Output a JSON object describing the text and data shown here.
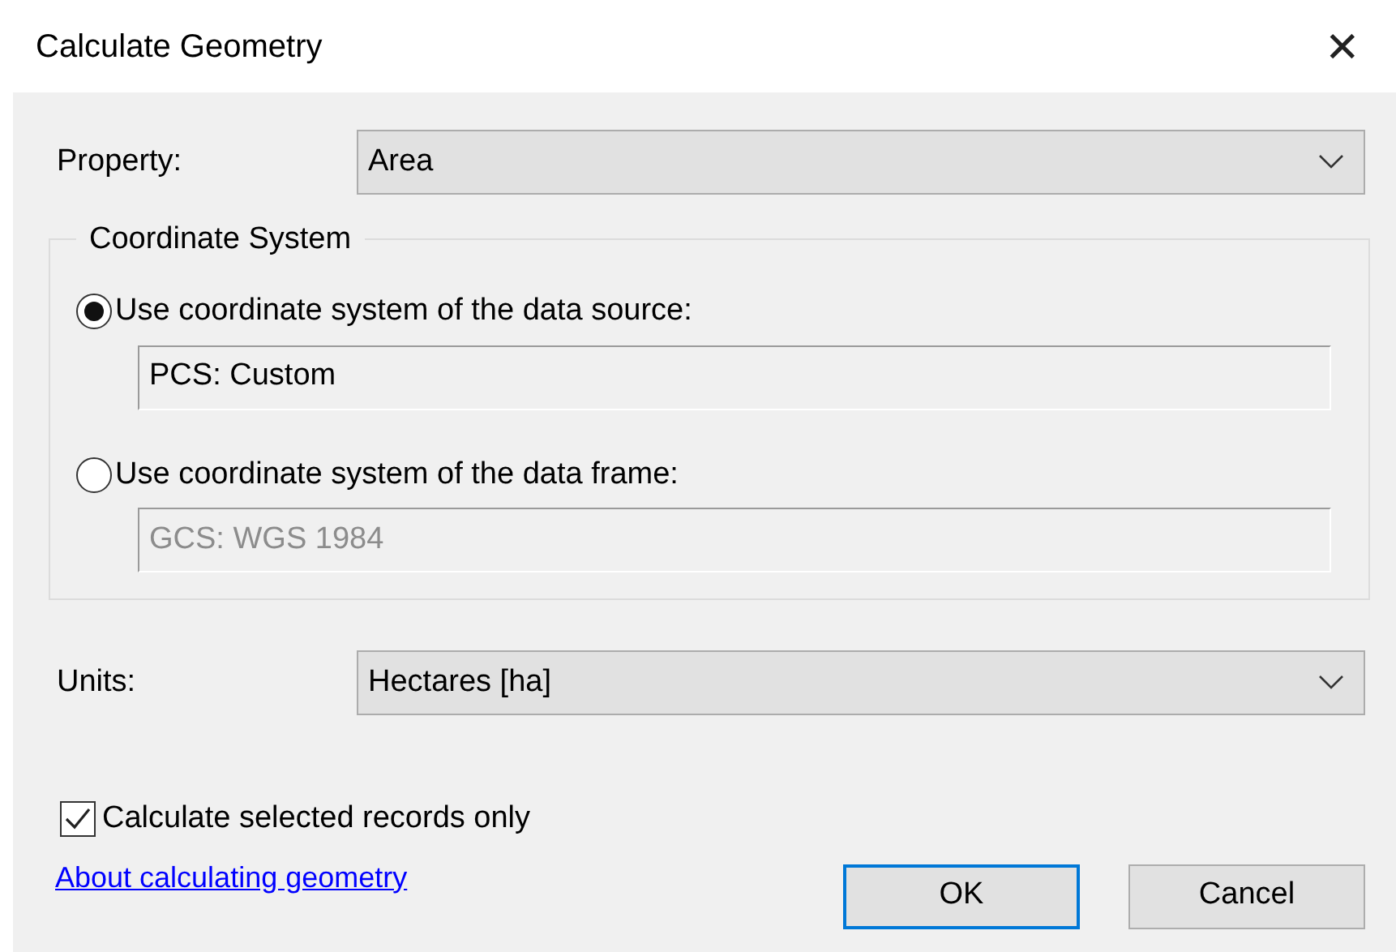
{
  "window": {
    "title": "Calculate Geometry",
    "close": "✕"
  },
  "property": {
    "label": "Property:",
    "value": "Area"
  },
  "coordinate_system": {
    "legend": "Coordinate System",
    "options": [
      {
        "label": "Use coordinate system of the data source:",
        "selected": true,
        "value": "PCS: Custom",
        "disabled": false
      },
      {
        "label": "Use coordinate system of the data frame:",
        "selected": false,
        "value": "GCS: WGS 1984",
        "disabled": true
      }
    ]
  },
  "units": {
    "label": "Units:",
    "value": "Hectares [ha]"
  },
  "selected_only": {
    "label": "Calculate selected records only",
    "checked": true
  },
  "help_link": "About calculating geometry",
  "buttons": [
    {
      "label": "OK",
      "default": true
    },
    {
      "label": "Cancel",
      "default": false
    }
  ]
}
